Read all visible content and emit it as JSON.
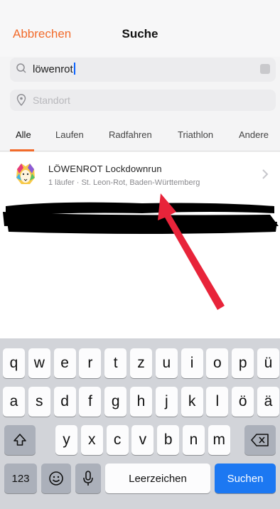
{
  "header": {
    "cancel_label": "Abbrechen",
    "title": "Suche"
  },
  "search": {
    "value": "löwenrot",
    "icon": "search-icon",
    "clear_icon": "clear-icon"
  },
  "location": {
    "placeholder": "Standort",
    "icon": "location-pin-icon"
  },
  "tabs": [
    {
      "label": "Alle",
      "active": true
    },
    {
      "label": "Laufen"
    },
    {
      "label": "Radfahren"
    },
    {
      "label": "Triathlon"
    },
    {
      "label": "Andere"
    }
  ],
  "result": {
    "name": "LÖWENROT Lockdownrun",
    "meta": "1 läufer · St. Leon-Rot, Baden-Württemberg",
    "avatar": "lion-logo",
    "chevron": "chevron-right-icon"
  },
  "keyboard": {
    "row1": [
      "q",
      "w",
      "e",
      "r",
      "t",
      "z",
      "u",
      "i",
      "o",
      "p",
      "ü"
    ],
    "row2": [
      "a",
      "s",
      "d",
      "f",
      "g",
      "h",
      "j",
      "k",
      "l",
      "ö",
      "ä"
    ],
    "row3": [
      "y",
      "x",
      "c",
      "v",
      "b",
      "n",
      "m"
    ],
    "numbers_label": "123",
    "space_label": "Leerzeichen",
    "search_label": "Suchen",
    "shift_icon": "shift-icon",
    "delete_icon": "backspace-icon",
    "emoji_icon": "emoji-icon",
    "mic_icon": "microphone-icon"
  },
  "colors": {
    "accent": "#f26b2b",
    "blue": "#1c78f2",
    "annotation_arrow": "#e8243a",
    "redaction": "#000000"
  }
}
